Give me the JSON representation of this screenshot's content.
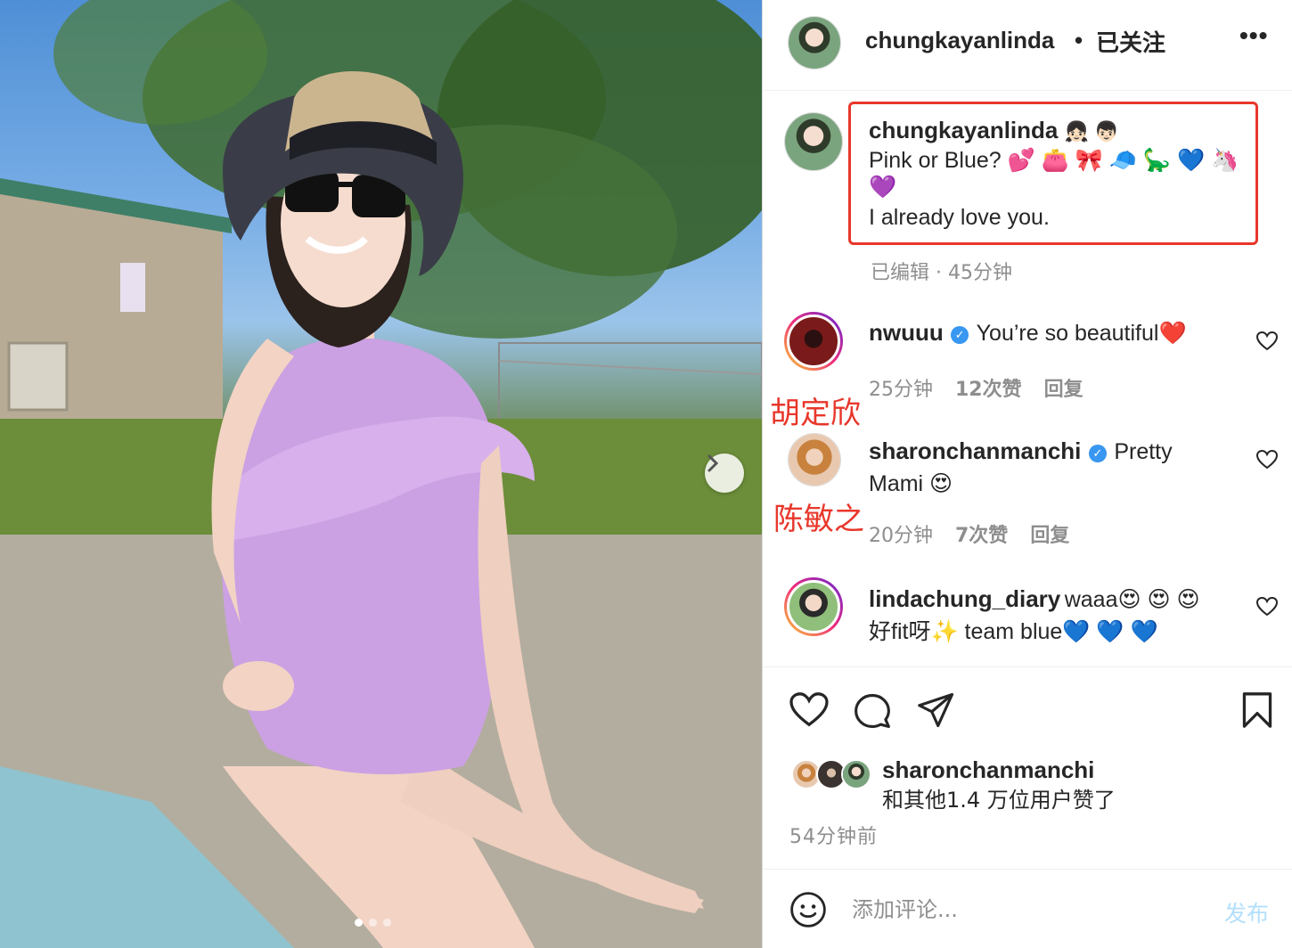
{
  "colors": {
    "accent": "#e8372b",
    "link_blue": "#3897f0",
    "muted": "#8e8e8e",
    "post_disabled": "#b2dffc"
  },
  "post": {
    "header": {
      "username": "chungkayanlinda",
      "separator": "•",
      "follow_status": "已关注",
      "more_label": "•••"
    },
    "caption": {
      "username": "chungkayanlinda",
      "username_emojis": "👧🏻 👦🏻",
      "line1": "Pink or Blue? 💕 👛 🎀 🧢 🦕 💙 🦄",
      "line2": "💜",
      "line3": "I already love you.",
      "meta": "已编辑 · 45分钟"
    },
    "comments": [
      {
        "username": "nwuuu",
        "verified": true,
        "text": "You’re so beautiful❤️",
        "time": "25分钟",
        "likes": "12次赞",
        "reply": "回复",
        "overlay_name": "胡定欣"
      },
      {
        "username": "sharonchanmanchi",
        "verified": true,
        "text": "Pretty",
        "text2": "Mami 😍",
        "time": "20分钟",
        "likes": "7次赞",
        "reply": "回复",
        "overlay_name": "陈敏之"
      },
      {
        "username": "lindachung_diary",
        "verified": false,
        "text": "waaa😍 😍 😍",
        "text2": "好fit呀✨  team blue💙 💙 💙"
      }
    ],
    "likes": {
      "username": "sharonchanmanchi",
      "rest": "和其他1.4 万位用户赞了"
    },
    "time_ago": "54分钟前",
    "add_comment": {
      "placeholder": "添加评论...",
      "post_label": "发布"
    },
    "carousel": {
      "current": 1,
      "total": 3
    }
  },
  "icons": [
    "heart-icon",
    "comment-icon",
    "share-icon",
    "bookmark-icon",
    "emoji-icon",
    "verified-icon",
    "chevron-right-icon",
    "more-icon"
  ]
}
